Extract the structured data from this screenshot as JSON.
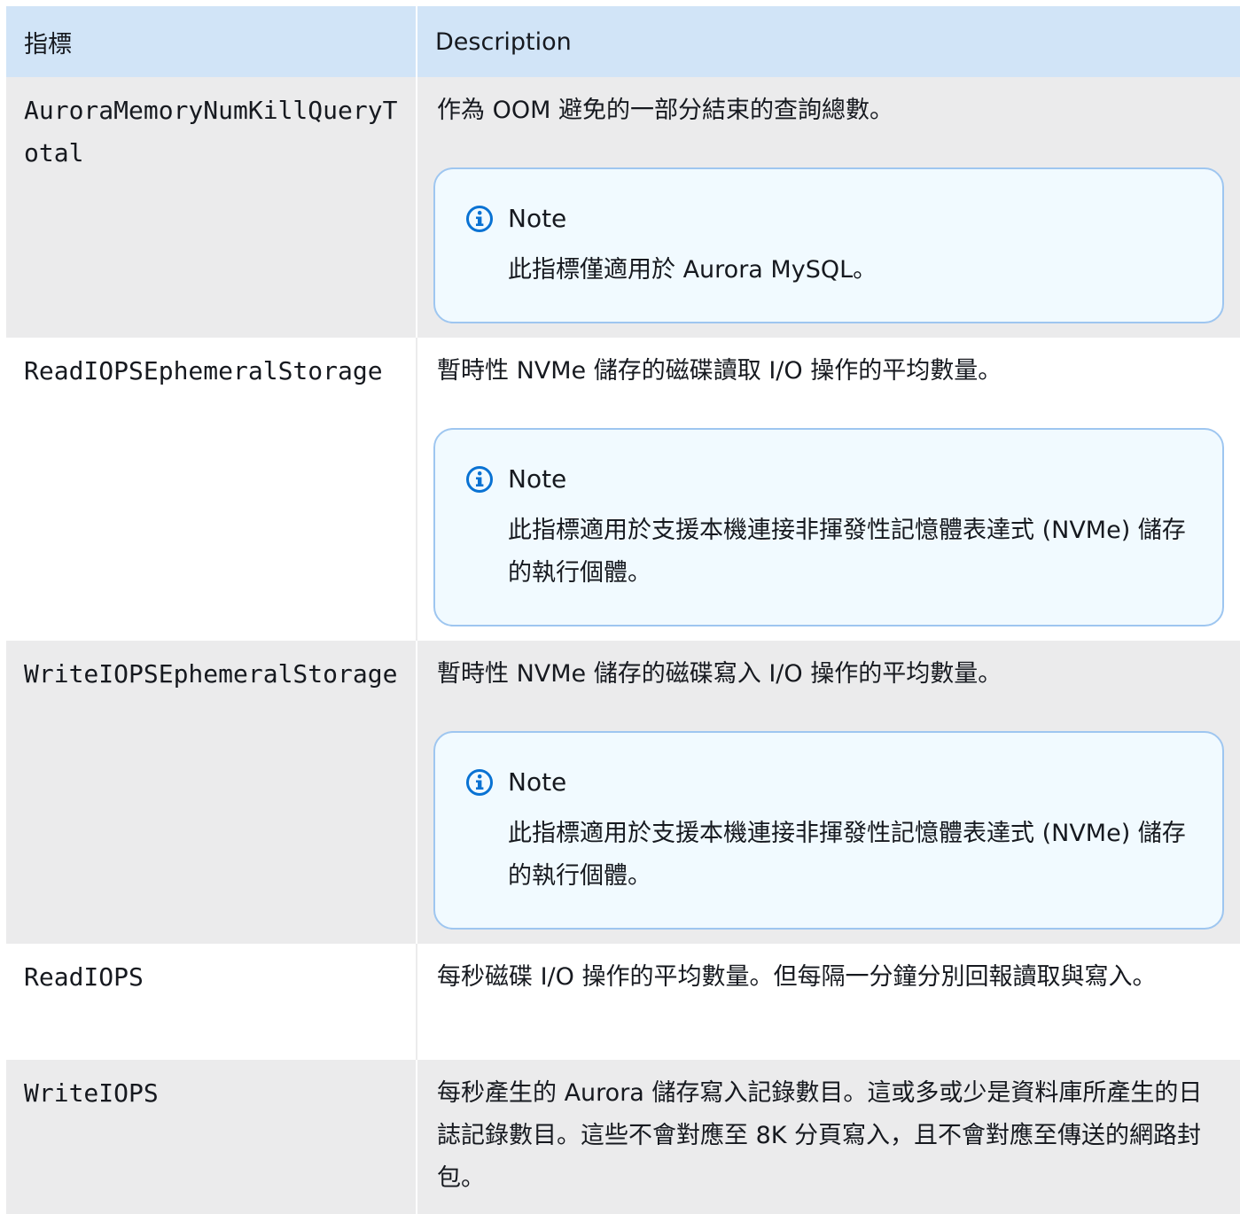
{
  "table": {
    "headers": {
      "metric": "指標",
      "description": "Description"
    },
    "rows": [
      {
        "metric": "AuroraMemoryNumKillQueryTotal",
        "description": "作為 OOM 避免的一部分結束的查詢總數。",
        "note": {
          "title": "Note",
          "text": "此指標僅適用於 Aurora MySQL。"
        }
      },
      {
        "metric": "ReadIOPSEphemeralStorage",
        "description": "暫時性 NVMe 儲存的磁碟讀取 I/O 操作的平均數量。",
        "note": {
          "title": "Note",
          "text": "此指標適用於支援本機連接非揮發性記憶體表達式 (NVMe) 儲存的執行個體。"
        }
      },
      {
        "metric": "WriteIOPSEphemeralStorage",
        "description": "暫時性 NVMe 儲存的磁碟寫入 I/O 操作的平均數量。",
        "note": {
          "title": "Note",
          "text": "此指標適用於支援本機連接非揮發性記憶體表達式 (NVMe) 儲存的執行個體。"
        }
      },
      {
        "metric": "ReadIOPS",
        "description": "每秒磁碟 I/O 操作的平均數量。但每隔一分鐘分別回報讀取與寫入。"
      },
      {
        "metric": "WriteIOPS",
        "description": "每秒產生的 Aurora 儲存寫入記錄數目。這或多或少是資料庫所產生的日誌記錄數目。這些不會對應至 8K 分頁寫入，且不會對應至傳送的網路封包。"
      }
    ]
  },
  "icons": {
    "note": "info-icon"
  },
  "colors": {
    "header_bg": "#d1e4f7",
    "row_alt_bg": "#ebebec",
    "note_bg": "#f1faff",
    "note_border": "#9ec6f0",
    "info_icon": "#0972d3"
  }
}
